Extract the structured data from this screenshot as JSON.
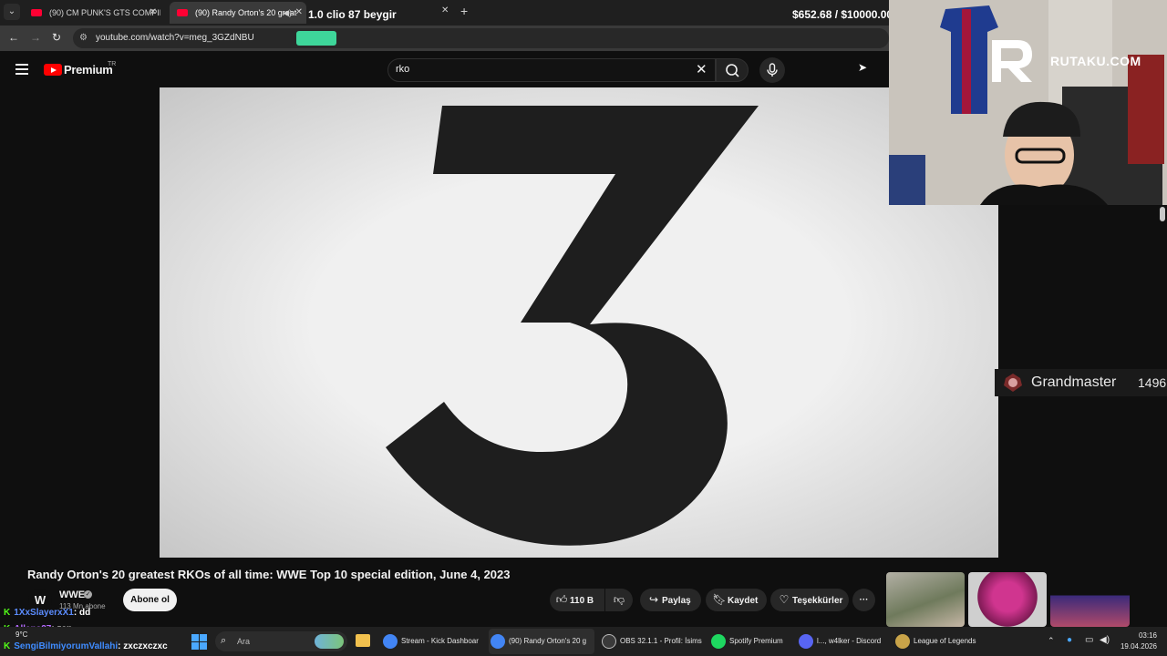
{
  "browser": {
    "tabs": [
      {
        "title": "(90) CM PUNK'S GTS COMPILAT",
        "active": false
      },
      {
        "title": "(90) Randy Orton's 20 great",
        "active": true
      }
    ],
    "url": "youtube.com/watch?v=meg_3GZdNBU"
  },
  "overlay": {
    "title": "1.0 clio 87 beygir",
    "money": "$652.68 / $10000.00",
    "brand": "RUTAKU.COM",
    "rank": "Grandmaster",
    "rank_points": "1496"
  },
  "youtube": {
    "logo": "Premium",
    "region": "TR",
    "search_value": "rko",
    "video_number": "3",
    "video_title": "Randy Orton's 20 greatest RKOs of all time: WWE Top 10 special edition, June 4, 2023",
    "channel": {
      "avatar": "W",
      "name": "WWE",
      "subs": "113 Mn abone",
      "subscribe_label": "Abone ol"
    },
    "actions": {
      "likes": "110 B",
      "share": "Paylaş",
      "save": "Kaydet",
      "thanks": "Teşekkürler",
      "more": "···"
    }
  },
  "chat": [
    {
      "user": "1XxSlayerxX1",
      "message": ": dd",
      "user_color": "#5b8cff"
    },
    {
      "user": "Allens27",
      "message": ": zap",
      "user_color": "#b46bff"
    },
    {
      "user": "SengiBilmiyorumVallahi",
      "message": ": zxczxczxc",
      "user_color": "#3f8cff"
    }
  ],
  "taskbar": {
    "search_placeholder": "Ara",
    "weather": "9°C",
    "items": [
      {
        "label": "Stream - Kick Dashboar",
        "color": "#4285f4",
        "active": false
      },
      {
        "label": "(90) Randy Orton's 20 g",
        "color": "#4285f4",
        "active": true
      },
      {
        "label": "OBS 32.1.1 - Profil: İsims",
        "color": "#3a3a3a",
        "active": false
      },
      {
        "label": "Spotify Premium",
        "color": "#1ed760",
        "active": false
      },
      {
        "label": "l..., w4lker - Discord",
        "color": "#5865f2",
        "active": false
      },
      {
        "label": "League of Legends",
        "color": "#c9a449",
        "active": false
      }
    ],
    "time": "03:16",
    "date": "19.04.2026"
  }
}
